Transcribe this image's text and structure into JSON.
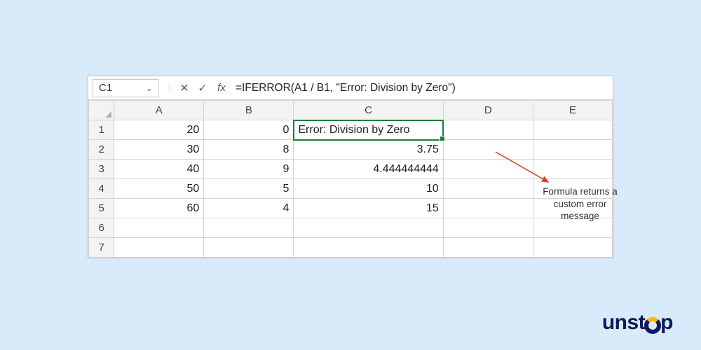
{
  "namebox": "C1",
  "formula": "=IFERROR(A1 / B1, \"Error: Division by Zero\")",
  "columns": [
    "A",
    "B",
    "C",
    "D",
    "E"
  ],
  "rows": [
    {
      "n": "1",
      "A": "20",
      "B": "0",
      "C": "Error: Division by Zero",
      "Ctxt": true
    },
    {
      "n": "2",
      "A": "30",
      "B": "8",
      "C": "3.75"
    },
    {
      "n": "3",
      "A": "40",
      "B": "9",
      "C": "4.444444444"
    },
    {
      "n": "4",
      "A": "50",
      "B": "5",
      "C": "10"
    },
    {
      "n": "5",
      "A": "60",
      "B": "4",
      "C": "15"
    },
    {
      "n": "6"
    },
    {
      "n": "7"
    }
  ],
  "annotation": "Formula returns a custom error message",
  "logo": "unstop",
  "chart_data": {
    "type": "table",
    "title": "IFERROR division example",
    "columns": [
      "A",
      "B",
      "C (=IFERROR(A/B,\"Error: Division by Zero\"))"
    ],
    "rows": [
      [
        20,
        0,
        "Error: Division by Zero"
      ],
      [
        30,
        8,
        3.75
      ],
      [
        40,
        9,
        4.444444444
      ],
      [
        50,
        5,
        10
      ],
      [
        60,
        4,
        15
      ]
    ]
  }
}
